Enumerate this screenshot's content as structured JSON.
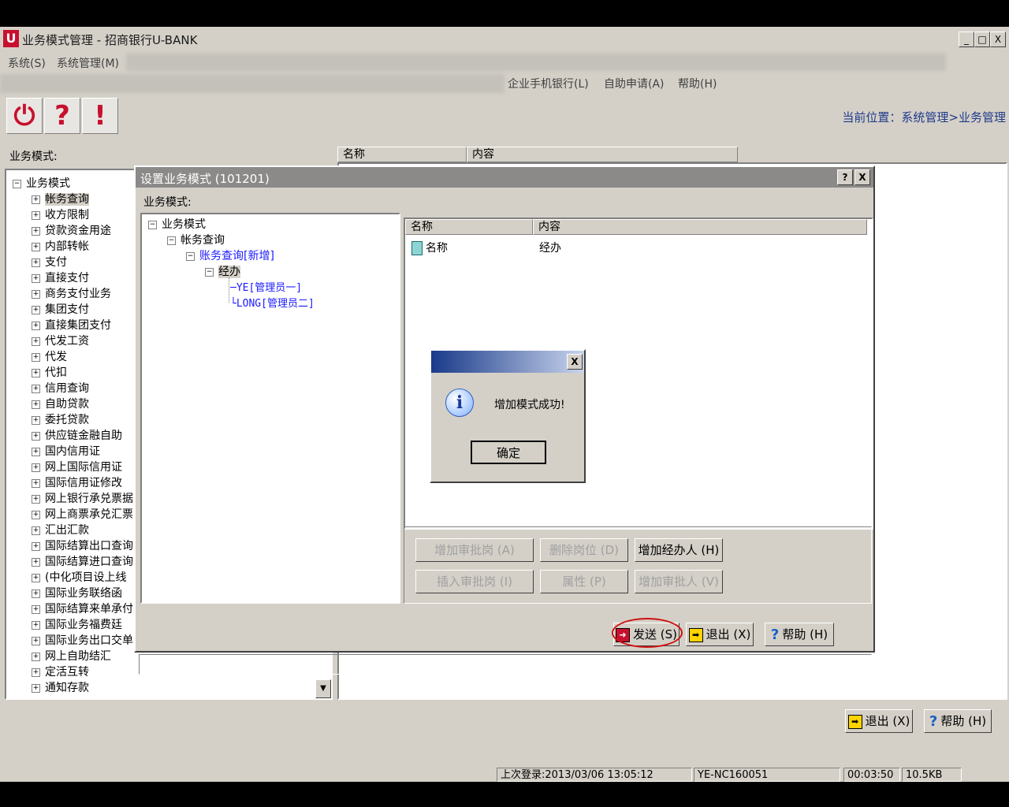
{
  "app": {
    "title": "业务模式管理 - 招商银行U-BANK",
    "logo": "U",
    "window_min": "_",
    "window_max": "□",
    "window_close": "X"
  },
  "menu": {
    "items": [
      "系统(S)",
      "系统管理(M)"
    ],
    "right_items": [
      "企业手机银行(L)",
      "自助申请(A)",
      "帮助(H)"
    ]
  },
  "toolbar": {
    "buttons": [
      {
        "icon": "power-icon",
        "glyph": "⏻"
      },
      {
        "icon": "question-icon",
        "glyph": "?"
      },
      {
        "icon": "exclamation-icon",
        "glyph": "!"
      }
    ],
    "location": "当前位置：系统管理>业务管理"
  },
  "left_panel": {
    "label": "业务模式:",
    "root": "业务模式",
    "items": [
      "帐务查询",
      "收方限制",
      "贷款资金用途",
      "内部转帐",
      "支付",
      "直接支付",
      "商务支付业务",
      "集团支付",
      "直接集团支付",
      "代发工资",
      "代发",
      "代扣",
      "信用查询",
      "自助贷款",
      "委托贷款",
      "供应链金融自助",
      "国内信用证",
      "网上国际信用证",
      "国际信用证修改",
      "网上银行承兑票据",
      "网上商票承兑汇票",
      "汇出汇款",
      "国际结算出口查询",
      "国际结算进口查询",
      "(中化项目设上线",
      "国际业务联络函",
      "国际结算来单承付",
      "国际业务福费廷",
      "国际业务出口交单",
      "网上自助结汇",
      "定活互转",
      "通知存款"
    ]
  },
  "main_headers": {
    "name": "名称",
    "content": "内容"
  },
  "dialog": {
    "title": "设置业务模式 (101201)",
    "help_btn": "?",
    "close_btn": "X",
    "tree_label": "业务模式:",
    "tree": {
      "root": "业务模式",
      "child": "帐务查询",
      "new_item": "账务查询[新增]",
      "role": "经办",
      "users": [
        "YE[管理员一]",
        "LONG[管理员二]"
      ]
    },
    "list_headers": {
      "name": "名称",
      "content": "内容"
    },
    "list_row": {
      "name": "名称",
      "content": "经办"
    },
    "buttons_row1": [
      "增加审批岗 (A)",
      "删除岗位 (D)",
      "增加经办人 (H)"
    ],
    "buttons_row2": [
      "插入审批岗 (I)",
      "属性 (P)",
      "增加审批人 (V)"
    ],
    "bottom_buttons": {
      "send": "发送 (S)",
      "exit": "退出 (X)",
      "help": "帮助 (H)"
    }
  },
  "message_box": {
    "close": "X",
    "text": "增加模式成功!",
    "ok": "确定"
  },
  "footer_buttons": {
    "exit": "退出 (X)",
    "help": "帮助 (H)"
  },
  "status_bar": {
    "last_login": "上次登录:2013/03/06 13:05:12",
    "user": "YE-NC160051",
    "time": "00:03:50",
    "size": "10.5KB"
  },
  "colors": {
    "accent_red": "#c8102e",
    "link_blue": "#1a1aff",
    "location_blue": "#1f3a8a"
  }
}
